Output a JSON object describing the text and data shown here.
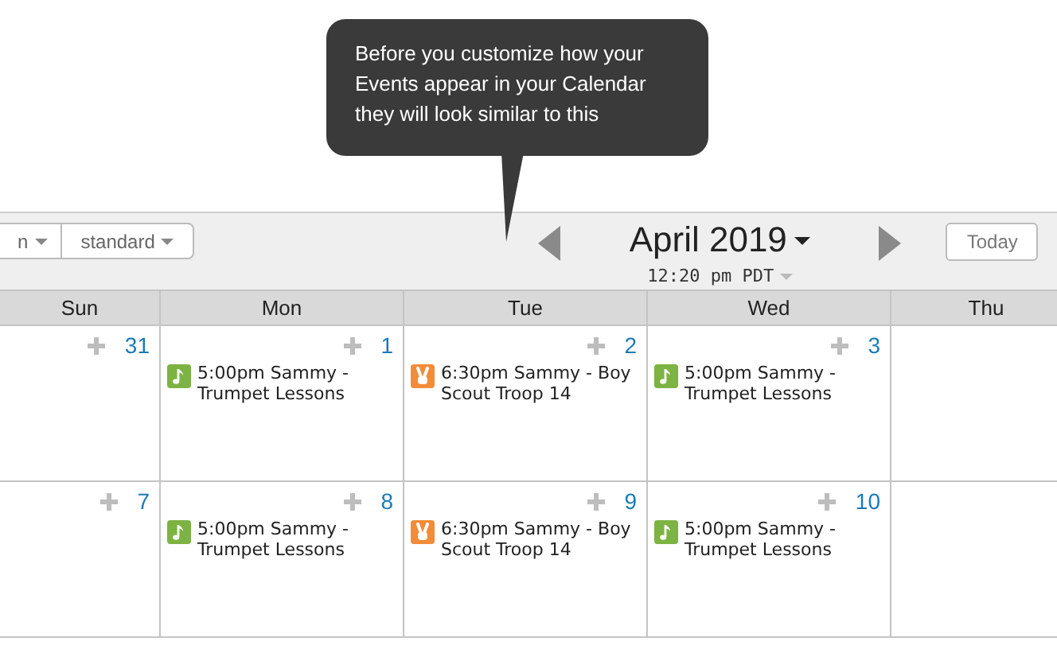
{
  "tooltip": {
    "text": "Before you customize how your Events appear in your Calendar they will look similar to this"
  },
  "toolbar": {
    "view_buttons": [
      {
        "label": "n"
      },
      {
        "label": "standard"
      }
    ],
    "month_title": "April 2019",
    "time": "12:20 pm PDT",
    "today_button": "Today"
  },
  "columns": [
    "Sun",
    "Mon",
    "Tue",
    "Wed",
    "Thu"
  ],
  "weeks": [
    {
      "days": [
        {
          "number": "31"
        },
        {
          "number": "1",
          "events": [
            {
              "kind": "music",
              "color": "#7cb342",
              "text": "5:00pm Sammy - Trumpet Lessons"
            }
          ]
        },
        {
          "number": "2",
          "events": [
            {
              "kind": "peace",
              "color": "#f28c38",
              "text": "6:30pm Sammy - Boy Scout Troop 14"
            }
          ]
        },
        {
          "number": "3",
          "events": [
            {
              "kind": "music",
              "color": "#7cb342",
              "text": "5:00pm Sammy - Trumpet Lessons"
            }
          ]
        }
      ]
    },
    {
      "days": [
        {
          "number": "7"
        },
        {
          "number": "8",
          "events": [
            {
              "kind": "music",
              "color": "#7cb342",
              "text": "5:00pm Sammy - Trumpet Lessons"
            }
          ]
        },
        {
          "number": "9",
          "events": [
            {
              "kind": "peace",
              "color": "#f28c38",
              "text": "6:30pm Sammy - Boy Scout Troop 14"
            }
          ]
        },
        {
          "number": "10",
          "events": [
            {
              "kind": "music",
              "color": "#7cb342",
              "text": "5:00pm Sammy - Trumpet Lessons"
            }
          ]
        }
      ]
    }
  ]
}
